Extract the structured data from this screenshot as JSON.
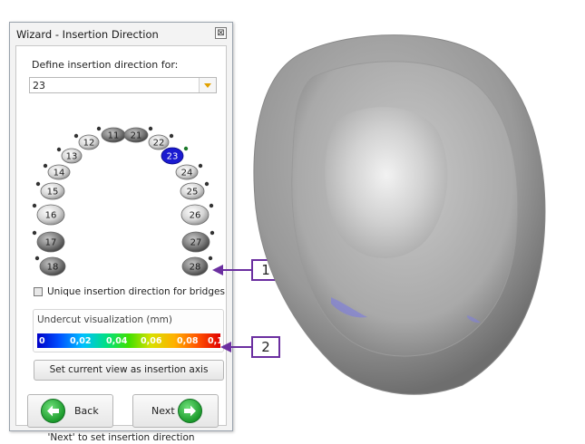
{
  "wizard": {
    "title": "Wizard - Insertion Direction",
    "close_label": "⊠",
    "define_label": "Define insertion direction for:",
    "selected_tooth": "23",
    "teeth": [
      "11",
      "12",
      "13",
      "14",
      "15",
      "16",
      "17",
      "18",
      "21",
      "22",
      "23",
      "24",
      "25",
      "26",
      "27",
      "28"
    ],
    "selected_color": "#1a1ad0",
    "bridge_label": "Unique insertion direction for bridges",
    "bridge_checked": false,
    "undercut": {
      "label": "Undercut visualization (mm)",
      "ticks": [
        "0",
        "0,02",
        "0,04",
        "0,06",
        "0,08",
        "0,1"
      ]
    },
    "set_axis_label": "Set current view as insertion axis",
    "back_label": "Back",
    "next_label": "Next",
    "hint": "'Next' to set insertion direction",
    "accent_green": "#1c9b2c"
  },
  "callouts": [
    "1",
    "2"
  ],
  "callout_color": "#6b2fa0"
}
